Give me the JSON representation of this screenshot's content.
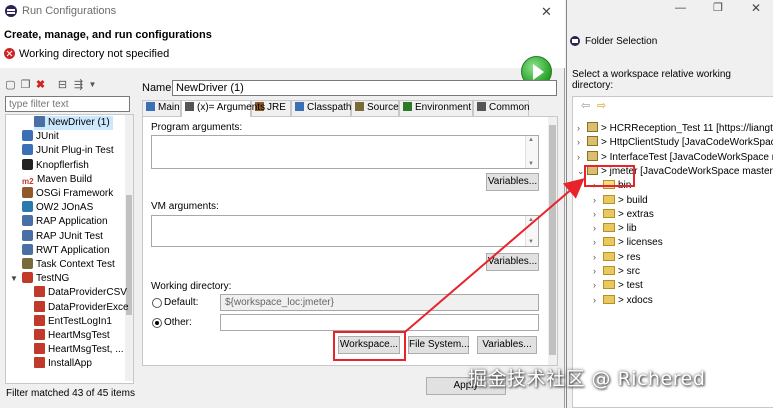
{
  "main_window": {
    "title": "Run Configurations",
    "close_glyph": "✕",
    "header_title": "Create, manage, and run configurations",
    "error_message": "Working directory not specified"
  },
  "sidebar": {
    "filter_placeholder": "type filter text",
    "items": [
      {
        "label": "NewDriver (1)",
        "indent": 1,
        "color": "#4a6fa5",
        "selected": true
      },
      {
        "label": "JUnit",
        "indent": 0,
        "color": "#3b6fb6"
      },
      {
        "label": "JUnit Plug-in Test",
        "indent": 0,
        "color": "#3b6fb6"
      },
      {
        "label": "Knopflerfish",
        "indent": 0,
        "color": "#222222"
      },
      {
        "label": "Maven Build",
        "indent": 0,
        "color": "#c0392b",
        "prefix": "m2"
      },
      {
        "label": "OSGi Framework",
        "indent": 0,
        "color": "#8e5a2a"
      },
      {
        "label": "OW2 JOnAS",
        "indent": 0,
        "color": "#2a7ab0"
      },
      {
        "label": "RAP Application",
        "indent": 0,
        "color": "#4a6fa5"
      },
      {
        "label": "RAP JUnit Test",
        "indent": 0,
        "color": "#4a6fa5"
      },
      {
        "label": "RWT Application",
        "indent": 0,
        "color": "#4a6fa5"
      },
      {
        "label": "Task Context Test",
        "indent": 0,
        "color": "#7a6a3a"
      },
      {
        "label": "TestNG",
        "indent": 0,
        "color": "#c0392b",
        "expanded": true
      },
      {
        "label": "DataProviderCSV",
        "indent": 1,
        "color": "#c0392b"
      },
      {
        "label": "DataProviderExce",
        "indent": 1,
        "color": "#c0392b"
      },
      {
        "label": "EntTestLogIn1",
        "indent": 1,
        "color": "#c0392b"
      },
      {
        "label": "HeartMsgTest",
        "indent": 1,
        "color": "#c0392b"
      },
      {
        "label": "HeartMsgTest, ...",
        "indent": 1,
        "color": "#c0392b"
      },
      {
        "label": "InstallApp",
        "indent": 1,
        "color": "#c0392b"
      }
    ],
    "filter_status": "Filter matched 43 of 45 items"
  },
  "config": {
    "name_label": "Name:",
    "name_value": "NewDriver (1)",
    "tabs": [
      {
        "label": "Main",
        "color": "#3b6fb6"
      },
      {
        "label": "(x)= Arguments",
        "color": "#555555",
        "active": true
      },
      {
        "label": "JRE",
        "color": "#8e5a2a"
      },
      {
        "label": "Classpath",
        "color": "#3b6fb6"
      },
      {
        "label": "Source",
        "color": "#7a6a3a"
      },
      {
        "label": "Environment",
        "color": "#2a7a2a"
      },
      {
        "label": "Common",
        "color": "#555555"
      }
    ],
    "program_args_label": "Program arguments:",
    "vm_args_label": "VM arguments:",
    "variables_label": "Variables...",
    "working_dir_label": "Working directory:",
    "default_label": "Default:",
    "default_value": "${workspace_loc:jmeter}",
    "other_label": "Other:",
    "other_value": "",
    "workspace_button": "Workspace...",
    "filesystem_button": "File System...",
    "apply_button": "Apply"
  },
  "folder_selection": {
    "title": "Folder Selection",
    "min_glyph": "—",
    "max_glyph": "❐",
    "close_glyph": "✕",
    "prompt": "Select a workspace relative working directory:",
    "nav_glyphs": [
      "⇦",
      "⇨"
    ],
    "nodes": [
      {
        "label": "> HCRReception_Test 11 [https://liangta",
        "indent": 0,
        "type": "project",
        "chevron": "›"
      },
      {
        "label": "> HttpClientStudy  [JavaCodeWorkSpace",
        "indent": 0,
        "type": "project",
        "chevron": "›"
      },
      {
        "label": "> InterfaceTest  [JavaCodeWorkSpace m",
        "indent": 0,
        "type": "project",
        "chevron": "›"
      },
      {
        "label": "> jmeter  [JavaCodeWorkSpace master]",
        "indent": 0,
        "type": "project",
        "chevron": "⌄"
      },
      {
        "label": "bin",
        "indent": 1,
        "type": "folder",
        "chevron": "›",
        "open": true
      },
      {
        "label": "> build",
        "indent": 1,
        "type": "folder",
        "chevron": "›"
      },
      {
        "label": "> extras",
        "indent": 1,
        "type": "folder",
        "chevron": "›"
      },
      {
        "label": "> lib",
        "indent": 1,
        "type": "folder",
        "chevron": "›"
      },
      {
        "label": "> licenses",
        "indent": 1,
        "type": "folder",
        "chevron": "›"
      },
      {
        "label": "> res",
        "indent": 1,
        "type": "folder",
        "chevron": "›"
      },
      {
        "label": "> src",
        "indent": 1,
        "type": "folder",
        "chevron": "›"
      },
      {
        "label": "> test",
        "indent": 1,
        "type": "folder",
        "chevron": "›"
      },
      {
        "label": "> xdocs",
        "indent": 1,
        "type": "folder",
        "chevron": "›"
      }
    ]
  },
  "watermark": "掘金技术社区 @ Richered",
  "colors": {
    "highlight": "#e8232b",
    "selection": "#cce8ff",
    "accent": "#3b6fb6"
  }
}
